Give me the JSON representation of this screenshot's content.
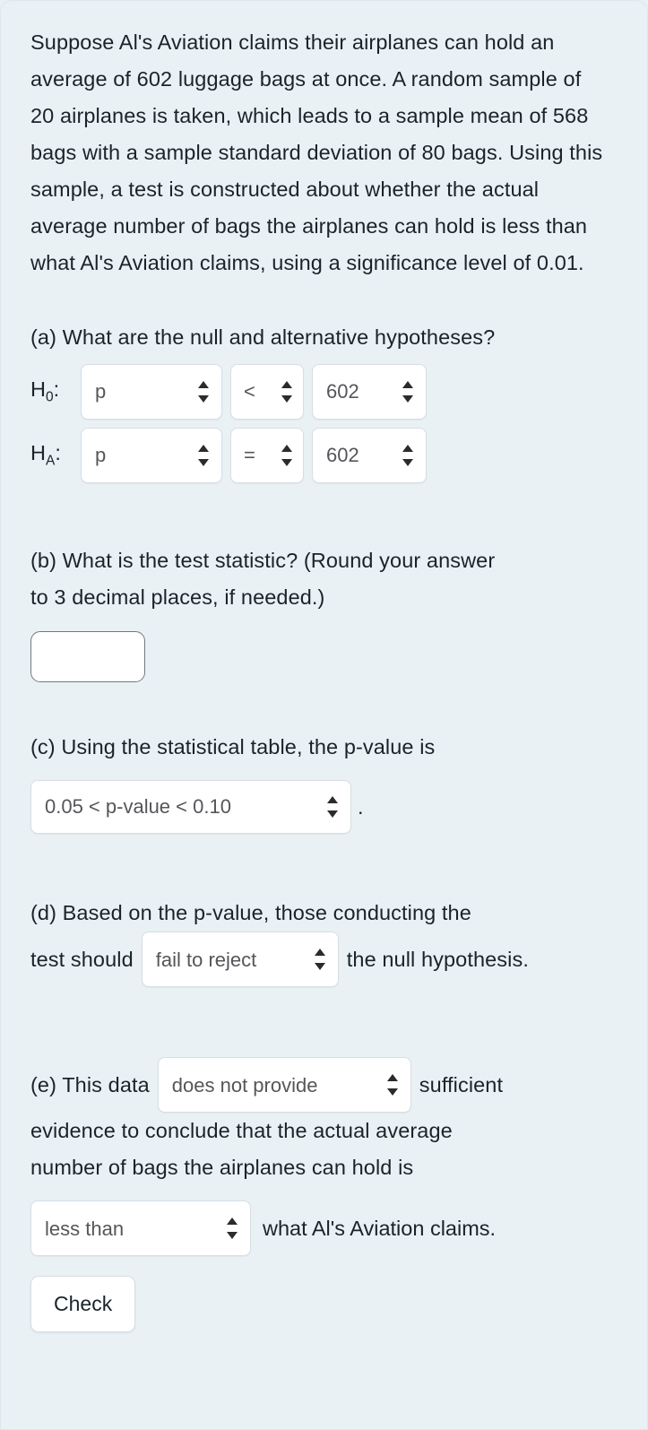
{
  "problem": {
    "text": "Suppose Al's Aviation claims their airplanes can hold an average of 602 luggage bags at once. A random sample of 20 airplanes is taken, which leads to a sample mean of 568 bags with a sample standard deviation of 80 bags. Using this sample, a test is constructed about whether the actual average number of bags the airplanes can hold is less than what Al's Aviation claims, using a significance level of 0.01."
  },
  "part_a": {
    "question": "(a) What are the null and alternative hypotheses?",
    "null_label_base": "H",
    "null_label_sub": "0",
    "alt_label_base": "H",
    "alt_label_sub": "A",
    "colon": ":",
    "null": {
      "parameter": "p",
      "operator": "<",
      "value": "602"
    },
    "alt": {
      "parameter": "p",
      "operator": "=",
      "value": "602"
    }
  },
  "part_b": {
    "question_line1": "(b) What is the test statistic? (Round your answer",
    "question_line2": "to 3 decimal places, if needed.)",
    "answer_value": "",
    "answer_placeholder": ""
  },
  "part_c": {
    "question": "(c) Using the statistical table, the p-value is",
    "selected": "0.05 < p-value < 0.10",
    "trailing_punctuation": "."
  },
  "part_d": {
    "question_line1": "(d) Based on the p-value, those conducting the",
    "lead_text": "test should",
    "selected": "fail to reject",
    "trail_text": "the null hypothesis."
  },
  "part_e": {
    "lead_text": "(e) This data",
    "selected_provide": "does not provide",
    "after_provide": "sufficient",
    "body_line1": "evidence to conclude that the actual average",
    "body_line2": "number of bags the airplanes can hold is",
    "selected_comparison": "less than",
    "tail_text": "what Al's Aviation claims."
  },
  "actions": {
    "check_label": "Check"
  },
  "icons": {
    "stepper": "updown-stepper-icon"
  },
  "colors": {
    "page_background": "#eaf1f5",
    "field_background": "#ffffff",
    "field_border": "#d6dee3",
    "input_border": "#6d7a82",
    "body_text": "#19242a",
    "field_text": "#55565a"
  }
}
